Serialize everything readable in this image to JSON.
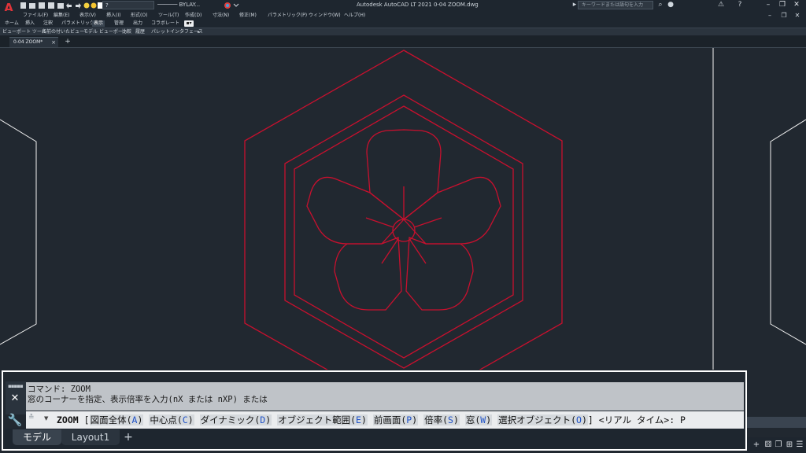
{
  "colors": {
    "canvas": "#212830",
    "drawing_red": "#c8102e",
    "geometry_white": "#f2f2f2",
    "option_key_blue": "#1f52c8"
  },
  "icons": {
    "app_logo": "autocad-logo-icon",
    "quick_access": [
      "new-icon",
      "open-icon",
      "save-icon",
      "saveas-icon",
      "print-icon",
      "undo-icon",
      "redo-icon",
      "lightbulb-icon",
      "sun-icon",
      "square-icon"
    ],
    "window_controls": [
      "minimize-icon",
      "restore-icon",
      "close-icon"
    ]
  },
  "titlebar": {
    "app_logo_letter": "A",
    "layer_value": "?",
    "linetype_value": "────── BYLAY...",
    "title": "Autodesk AutoCAD LT 2021    0-04 ZOOM.dwg",
    "search_placeholder": "キーワードまたは語句を入力",
    "window_controls": [
      "–",
      "❐",
      "✕"
    ]
  },
  "menubar": {
    "items": [
      "ファイル(F)",
      "編集(E)",
      "表示(V)",
      "挿入(I)",
      "形式(O)",
      "ツール(T)",
      "作成(D)",
      "寸法(N)",
      "修正(M)",
      "パラメトリック(P)",
      "ウィンドウ(W)",
      "ヘルプ(H)"
    ],
    "controls": [
      "–",
      "❐",
      "✕"
    ]
  },
  "ribbon": {
    "tabs": [
      "ホーム",
      "挿入",
      "注釈",
      "パラメトリック",
      "表示",
      "管理",
      "出力",
      "コラボレート"
    ],
    "active_tab": "表示",
    "toggle": "▪▾",
    "panels": [
      "ビューポート ツール",
      "名前の付いたビュー",
      "モデル ビューポート",
      "比較",
      "履歴",
      "パレット",
      "インタフェース",
      "▸"
    ]
  },
  "file_tabs": {
    "active": "0-04 ZOOM*",
    "close": "×",
    "add": "+"
  },
  "command": {
    "grip": "▪▪▪▪▪",
    "close": "✕",
    "history": [
      "コマンド: ZOOM",
      "窓のコーナーを指定、表示倍率を入力(nX または nXP) または"
    ],
    "recent_icon": "≛",
    "dropdown": "▼",
    "wrench": "🔧",
    "command_name": "ZOOM",
    "open_bracket": "[",
    "options": [
      {
        "label": "図面全体(",
        "key": "A",
        "end": ")"
      },
      {
        "label": "中心点(",
        "key": "C",
        "end": ")"
      },
      {
        "label": "ダイナミック(",
        "key": "D",
        "end": ")"
      },
      {
        "label": "オブジェクト範囲(",
        "key": "E",
        "end": ")"
      },
      {
        "label": "前画面(",
        "key": "P",
        "end": ")"
      },
      {
        "label": "倍率(",
        "key": "S",
        "end": ")"
      },
      {
        "label": "窓(",
        "key": "W",
        "end": ")"
      },
      {
        "label": "選択オブジェクト(",
        "key": "O",
        "end": ")"
      }
    ],
    "close_bracket": "]",
    "tail": " <リアル タイム>: P"
  },
  "layout_tabs": {
    "model": "モデル",
    "layout1": "Layout1",
    "add": "+"
  },
  "statusbar": {
    "icons": [
      "+",
      "⚄",
      "❐",
      "⊞",
      "☰"
    ]
  }
}
